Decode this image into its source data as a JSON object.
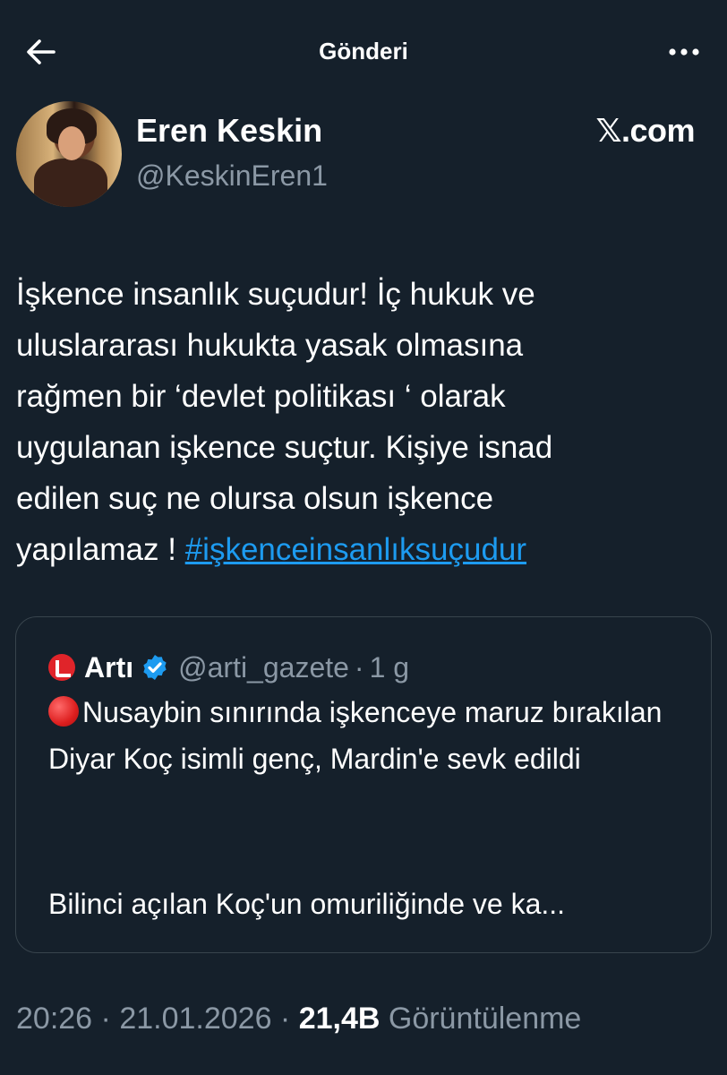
{
  "header": {
    "title": "Gönderi",
    "back_icon": "arrow-left-icon",
    "more_icon": "more-horizontal-icon"
  },
  "author": {
    "name": "Eren Keskin",
    "handle": "@KeskinEren1",
    "platform": "𝕏.com"
  },
  "tweet": {
    "text": "İşkence insanlık suçudur! İç hukuk ve\nuluslararası hukukta yasak olmasına\nrağmen bir ‘devlet politikası ‘ olarak\nuygulanan işkence suçtur. Kişiye isnad\nedilen suç ne olursa olsun işkence\nyapılamaz ! ",
    "hashtag": "#işkenceinsanlıksuçudur"
  },
  "quote": {
    "name": "Artı",
    "handle": "@arti_gazete",
    "separator": "·",
    "time": "1 g",
    "text": "Nusaybin sınırında işkenceye maruz bırakılan Diyar Koç isimli genç, Mardin'e sevk edildi",
    "text2": "Bilinci açılan Koç'un omuriliğinde ve ka...",
    "colors": {
      "logo": "#e0242a",
      "verified": "#1d9bf0"
    }
  },
  "meta": {
    "time": "20:26",
    "sep1": " · ",
    "date": "21.01.2026",
    "sep2": " · ",
    "views": "21,4B",
    "views_label": " Görüntülenme"
  },
  "colors": {
    "background": "#15202b",
    "text": "#ffffff",
    "muted": "#8b98a5",
    "link": "#1d9bf0",
    "border": "#38444d"
  }
}
